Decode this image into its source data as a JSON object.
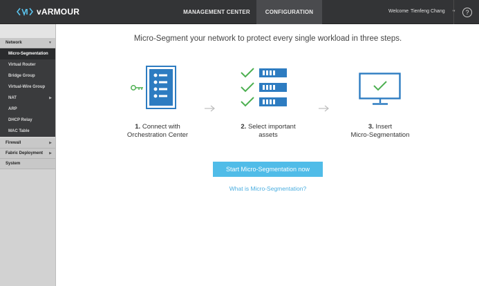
{
  "app": {
    "logo_text": "vARMOUR"
  },
  "topnav": {
    "tabs": [
      {
        "label": "MANAGEMENT CENTER"
      },
      {
        "label": "CONFIGURATION"
      }
    ],
    "active_tab": "CONFIGURATION"
  },
  "user": {
    "welcome": "Welcome",
    "name": "Tienfeng Chang"
  },
  "sidebar": {
    "network": {
      "label": "Network",
      "items": [
        {
          "label": "Micro-Segmentation"
        },
        {
          "label": "Virtual Router"
        },
        {
          "label": "Bridge Group"
        },
        {
          "label": "Virtual-Wire Group"
        },
        {
          "label": "NAT"
        },
        {
          "label": "ARP"
        },
        {
          "label": "DHCP Relay"
        },
        {
          "label": "MAC Table"
        }
      ]
    },
    "firewall": {
      "label": "Firewall"
    },
    "fabric": {
      "label": "Fabric Deployment"
    },
    "system": {
      "label": "System"
    }
  },
  "main": {
    "headline": "Micro-Segment your network to protect every single workload in three steps.",
    "steps": [
      {
        "number": "1.",
        "line1": "Connect with",
        "line2": "Orchestration Center",
        "icon": "key-server-icon"
      },
      {
        "number": "2.",
        "line1": "Select important",
        "line2": "assets",
        "icon": "checked-servers-icon"
      },
      {
        "number": "3.",
        "line1": "Insert",
        "line2": "Micro-Segmentation",
        "icon": "monitor-check-icon"
      }
    ],
    "cta_label": "Start Micro-Segmentation now",
    "link_label": "What is Micro-Segmentation?"
  },
  "colors": {
    "accent_blue": "#2d7cc1",
    "check_green": "#4caf50",
    "cta_blue": "#50bce8",
    "link_blue": "#4aaee0",
    "topbar": "#333436"
  }
}
